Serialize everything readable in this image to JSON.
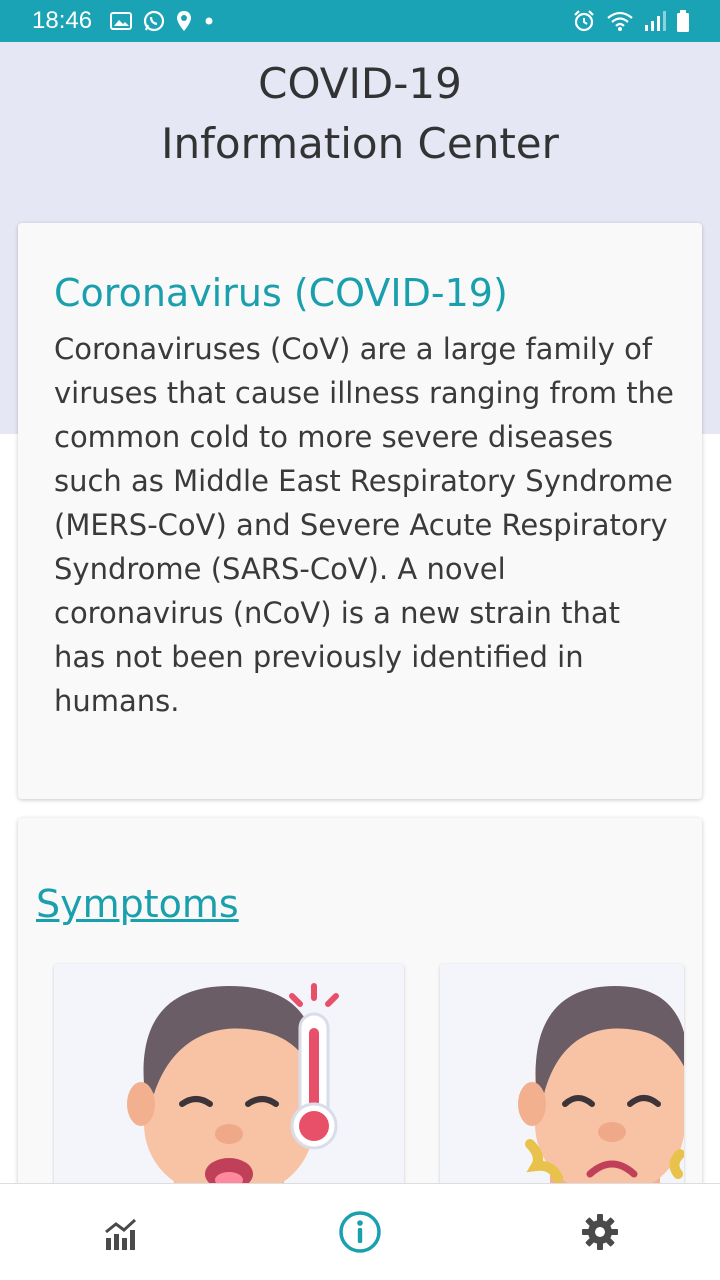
{
  "status_bar": {
    "time": "18:46",
    "icons_left": [
      "image-icon",
      "whatsapp-icon",
      "location-icon",
      "dot-icon"
    ],
    "icons_right": [
      "alarm-icon",
      "wifi-icon",
      "signal-icon",
      "battery-icon"
    ]
  },
  "header": {
    "title_line1": "COVID-19",
    "title_line2": "Information Center"
  },
  "info_card": {
    "heading": "Coronavirus (COVID-19)",
    "body": "Coronaviruses (CoV) are a large family of viruses that cause illness ranging from the common cold to more severe diseases such as Middle East Respiratory Syndrome (MERS-CoV) and Severe Acute Respiratory Syndrome (SARS-CoV). A novel coronavirus (nCoV) is a new strain that has not been previously identified in humans."
  },
  "symptoms": {
    "heading": "Symptoms",
    "tiles": [
      "fever-illustration",
      "tiredness-illustration"
    ]
  },
  "bottom_nav": {
    "items": [
      "stats-icon",
      "info-icon",
      "settings-icon"
    ],
    "active": "info-icon"
  },
  "colors": {
    "status_bar": "#1aa3b4",
    "accent": "#1a9fad",
    "hero_bg": "#e6e7f5",
    "nav_inactive": "#4a4a4a"
  }
}
